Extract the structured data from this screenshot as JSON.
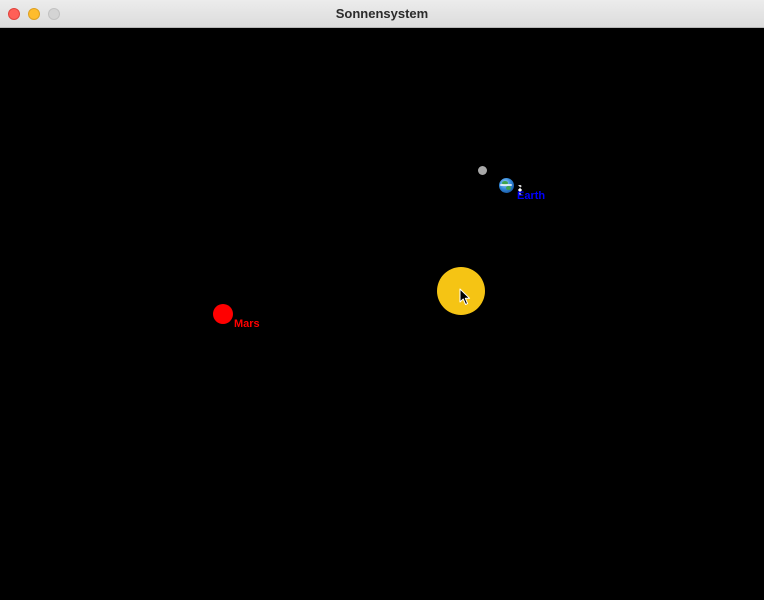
{
  "window": {
    "title": "Sonnensystem",
    "traffic_lights": [
      "close",
      "minimize",
      "zoom"
    ]
  },
  "scene": {
    "background_color": "#000000",
    "bodies": {
      "sun": {
        "color": "#f5c414"
      },
      "moon": {
        "color": "#a8a8a8"
      },
      "earth": {
        "label": "Earth",
        "label_color": "#0000ff",
        "icon": "earth-globe-icon"
      },
      "satellite": {
        "icon": "satellite-icon",
        "color": "#ffffff"
      },
      "mars": {
        "label": "Mars",
        "color": "#ff0000",
        "label_color": "#ff0000"
      }
    }
  },
  "cursor": {
    "icon": "mouse-pointer-icon"
  }
}
